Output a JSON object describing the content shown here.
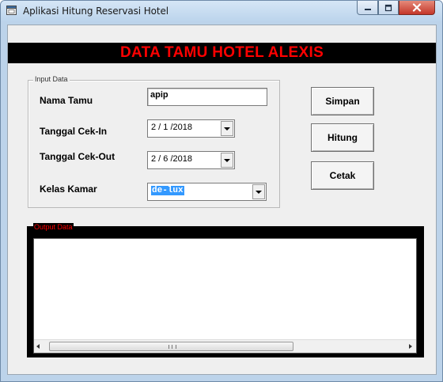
{
  "window": {
    "title": "Aplikasi Hitung Reservasi Hotel",
    "controls": {
      "minimize": "minimize-icon",
      "maximize": "maximize-icon",
      "close": "close-icon"
    }
  },
  "banner": {
    "text": "DATA TAMU HOTEL ALEXIS",
    "text_color": "#ff0000",
    "background": "#000000"
  },
  "input_group": {
    "legend": "Input Data",
    "nama_tamu": {
      "label": "Nama Tamu",
      "value": "apip"
    },
    "tanggal_cek_in": {
      "label": "Tanggal Cek-In",
      "value": "2 / 1 /2018"
    },
    "tanggal_cek_out": {
      "label": "Tanggal Cek-Out",
      "value": "2 / 6 /2018"
    },
    "kelas_kamar": {
      "label": "Kelas Kamar",
      "value": "de-lux"
    }
  },
  "buttons": {
    "simpan": "Simpan",
    "hitung": "Hitung",
    "cetak": "Cetak"
  },
  "output_group": {
    "legend": "Output Data",
    "legend_color": "#ff0000",
    "items": []
  }
}
